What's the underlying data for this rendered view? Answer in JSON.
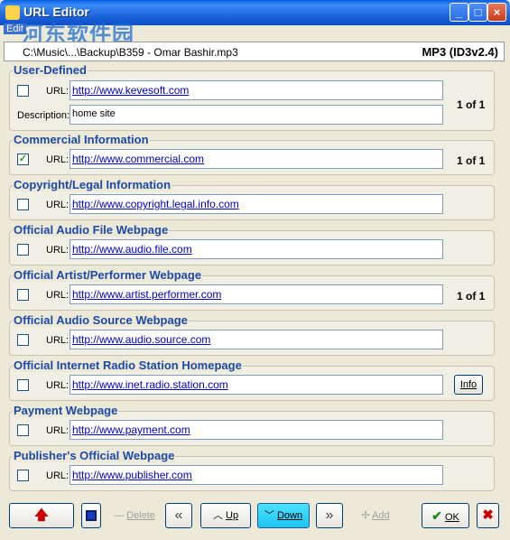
{
  "window": {
    "title": "URL Editor",
    "menu": "Edit",
    "watermark": "河东软件园",
    "buttons": [
      "minimize",
      "maximize",
      "close"
    ]
  },
  "file": {
    "path": "C:\\Music\\...\\Backup\\B359 - Omar Bashir.mp3",
    "format": "MP3 (ID3v2.4)"
  },
  "labels": {
    "url": "URL:",
    "description": "Description:"
  },
  "groups": [
    {
      "title": "User-Defined",
      "checked": false,
      "url": "http://www.kevesoft.com",
      "description": "home site",
      "count": "1 of 1"
    },
    {
      "title": "Commercial Information",
      "checked": true,
      "url": "http://www.commercial.com",
      "count": "1 of 1"
    },
    {
      "title": "Copyright/Legal Information",
      "checked": false,
      "url": "http://www.copyright.legal.info.com"
    },
    {
      "title": "Official Audio File Webpage",
      "checked": false,
      "url": "http://www.audio.file.com"
    },
    {
      "title": "Official Artist/Performer Webpage",
      "checked": false,
      "url": "http://www.artist.performer.com",
      "count": "1 of 1"
    },
    {
      "title": "Official Audio Source Webpage",
      "checked": false,
      "url": "http://www.audio.source.com"
    },
    {
      "title": "Official Internet Radio Station Homepage",
      "checked": false,
      "url": "http://www.inet.radio.station.com",
      "button": "Info"
    },
    {
      "title": "Payment Webpage",
      "checked": false,
      "url": "http://www.payment.com"
    },
    {
      "title": "Publisher's Official Webpage",
      "checked": false,
      "url": "http://www.publisher.com"
    }
  ],
  "toolbar": {
    "delete_label": "Delete",
    "up_label": "Up",
    "down_label": "Down",
    "add_label": "Add",
    "ok_label": "OK"
  }
}
